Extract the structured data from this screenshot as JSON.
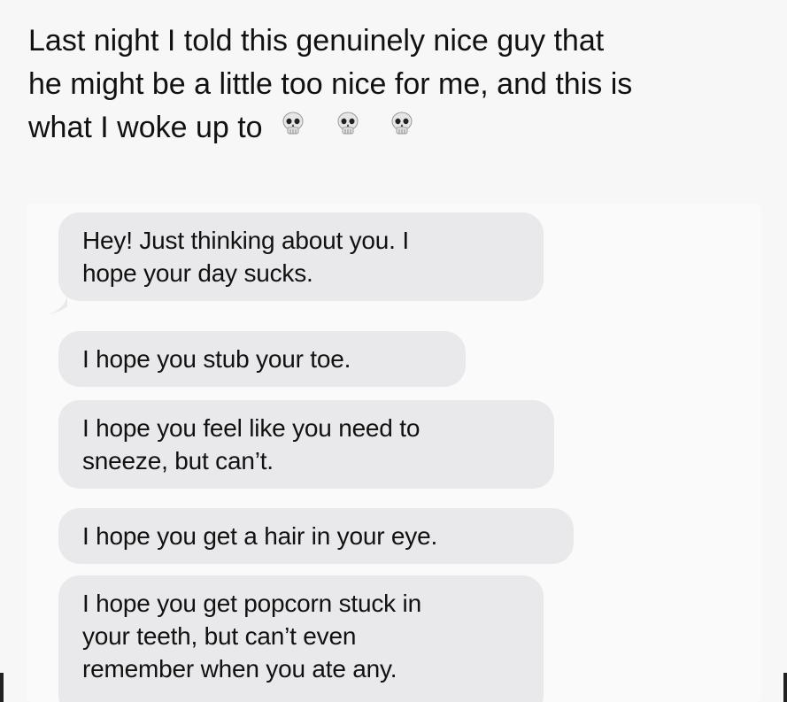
{
  "post": {
    "line1": "Last night I told this genuinely nice guy that",
    "line2": "he might be a little too nice for me, and this is",
    "line3": "what I woke up to",
    "emoji": [
      "skull-icon",
      "skull-icon",
      "skull-icon"
    ]
  },
  "messages": [
    {
      "lines": [
        "Hey! Just thinking about you. I",
        "hope your day sucks."
      ]
    },
    {
      "lines": [
        "I hope you stub your toe."
      ]
    },
    {
      "lines": [
        "I hope you feel like you need to",
        "sneeze, but can’t."
      ]
    },
    {
      "lines": [
        "I hope you get a hair in your eye."
      ]
    },
    {
      "lines": [
        "I hope you get popcorn stuck in",
        "your teeth, but can’t even",
        "remember when you ate any."
      ]
    }
  ],
  "colors": {
    "page_background": "#f7f7f7",
    "bubble_background": "#e9e9eb",
    "text": "#111111"
  }
}
